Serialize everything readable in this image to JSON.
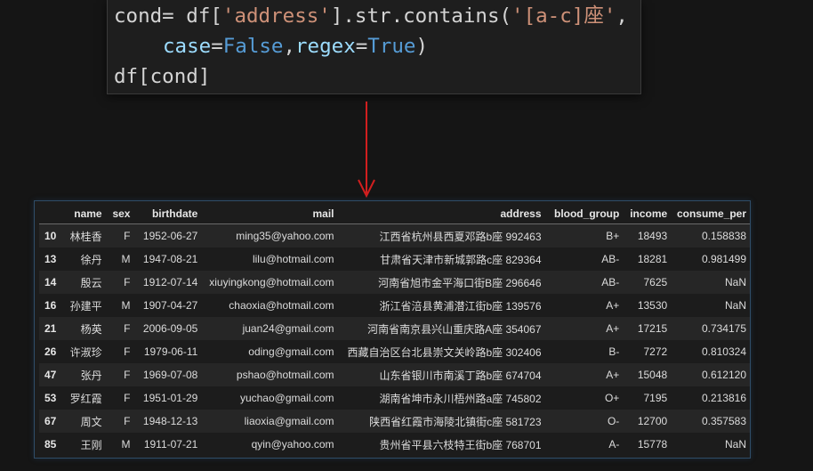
{
  "code": {
    "line1": {
      "var": "cond= df[",
      "str1": "'address'",
      "mid": "].str.contains(",
      "str2": "'[a-c]座'",
      "end": ","
    },
    "line2": {
      "p1": "case",
      "eq1": "=",
      "v1": "False",
      "comma": ",",
      "p2": "regex",
      "eq2": "=",
      "v2": "True",
      "close": ")"
    },
    "line3": {
      "text": "df[cond]"
    }
  },
  "arrow": {
    "color": "#d11f1f"
  },
  "table": {
    "headers": [
      "",
      "name",
      "sex",
      "birthdate",
      "mail",
      "address",
      "blood_group",
      "income",
      "consume_per"
    ],
    "rows": [
      [
        "10",
        "林桂香",
        "F",
        "1952-06-27",
        "ming35@yahoo.com",
        "江西省杭州县西夏邓路b座 992463",
        "B+",
        "18493",
        "0.158838"
      ],
      [
        "13",
        "徐丹",
        "M",
        "1947-08-21",
        "lilu@hotmail.com",
        "甘肃省天津市新城郭路c座 829364",
        "AB-",
        "18281",
        "0.981499"
      ],
      [
        "14",
        "殷云",
        "F",
        "1912-07-14",
        "xiuyingkong@hotmail.com",
        "河南省旭市金平海口街B座 296646",
        "AB-",
        "7625",
        "NaN"
      ],
      [
        "16",
        "孙建平",
        "M",
        "1907-04-27",
        "chaoxia@hotmail.com",
        "浙江省涪县黄浦潜江街b座 139576",
        "A+",
        "13530",
        "NaN"
      ],
      [
        "21",
        "杨英",
        "F",
        "2006-09-05",
        "juan24@gmail.com",
        "河南省南京县兴山重庆路A座 354067",
        "A+",
        "17215",
        "0.734175"
      ],
      [
        "26",
        "许淑珍",
        "F",
        "1979-06-11",
        "oding@gmail.com",
        "西藏自治区台北县崇文关岭路b座 302406",
        "B-",
        "7272",
        "0.810324"
      ],
      [
        "47",
        "张丹",
        "F",
        "1969-07-08",
        "pshao@hotmail.com",
        "山东省银川市南溪丁路b座 674704",
        "A+",
        "15048",
        "0.612120"
      ],
      [
        "53",
        "罗红霞",
        "F",
        "1951-01-29",
        "yuchao@gmail.com",
        "湖南省坤市永川梧州路a座 745802",
        "O+",
        "7195",
        "0.213816"
      ],
      [
        "67",
        "周文",
        "F",
        "1948-12-13",
        "liaoxia@gmail.com",
        "陕西省红霞市海陵北镇街c座 581723",
        "O-",
        "12700",
        "0.357583"
      ],
      [
        "85",
        "王刚",
        "M",
        "1911-07-21",
        "qyin@yahoo.com",
        "贵州省平县六枝特王街b座 768701",
        "A-",
        "15778",
        "NaN"
      ]
    ]
  }
}
